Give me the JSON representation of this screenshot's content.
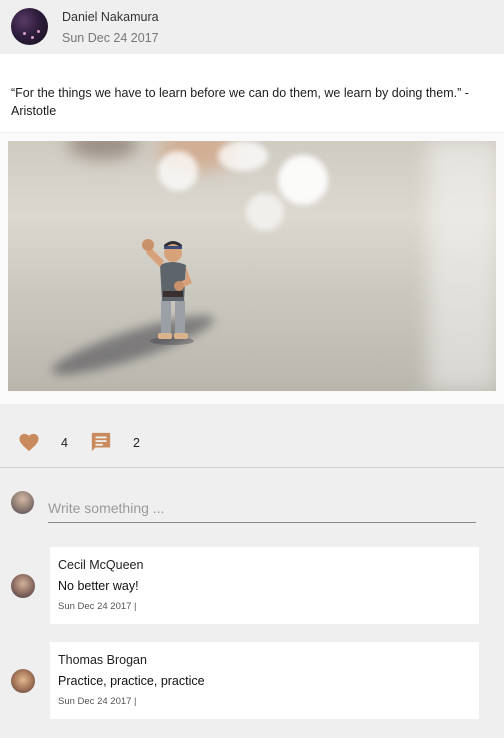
{
  "post": {
    "author": "Daniel Nakamura",
    "date": "Sun Dec 24 2017",
    "quote": "“For the things we have to learn before we can do them, we learn by doing them.” - Aristotle"
  },
  "actions": {
    "like_icon": "heart-icon",
    "like_count": "4",
    "comment_icon": "comment-icon",
    "comment_count": "2",
    "accent_color": "#c98b5e"
  },
  "composer": {
    "placeholder": "Write something ..."
  },
  "comments": [
    {
      "author": "Cecil McQueen",
      "text": "No better way!",
      "date": "Sun Dec 24 2017 |"
    },
    {
      "author": "Thomas Brogan",
      "text": "Practice, practice, practice",
      "date": "Sun Dec 24 2017 |"
    }
  ]
}
